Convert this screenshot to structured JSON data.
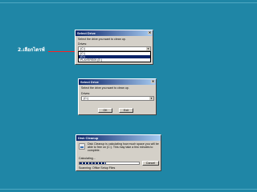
{
  "step_label": "2.เลือกไดรฟ์",
  "dialog1": {
    "title": "Select Drive",
    "prompt": "Select the drive you want to clean up.",
    "drives_label": "Drives:",
    "selected_drive": "(C:)",
    "options": [
      "(C:)",
      "(D:)",
      "PLAYERS09 (E:)"
    ]
  },
  "dialog2": {
    "title": "Select Drive",
    "prompt": "Select the drive you want to clean up.",
    "drives_label": "Drives:",
    "selected_drive": "(C:)",
    "ok_label": "OK",
    "exit_label": "Exit"
  },
  "dialog3": {
    "title": "Disk Cleanup",
    "message": "Disk Cleanup is calculating how much space you will be able to free on (C:). This may take a few minutes to complete.",
    "calculating_label": "Calculating...",
    "cancel_label": "Cancel",
    "scanning_text": "Scanning:  Office Setup Files",
    "progress": 0.45
  }
}
